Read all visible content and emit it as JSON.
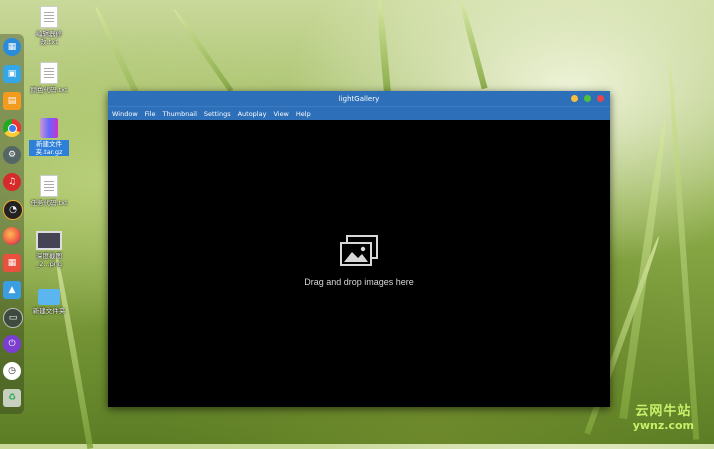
{
  "desktop": {
    "items": [
      {
        "label": "编辑器修\n改.txt",
        "type": "file"
      },
      {
        "label": "颜色代码.txt",
        "type": "file"
      },
      {
        "label": "新建文件\n夹.tar.gz",
        "type": "archive",
        "selected": true
      },
      {
        "label": "任务代码.txt",
        "type": "file"
      },
      {
        "label": "深度截图\n_2...png",
        "type": "image"
      },
      {
        "label": "新建文件夹",
        "type": "folder"
      }
    ]
  },
  "dock": {
    "icons": [
      "launcher-icon",
      "store-icon",
      "files-icon",
      "chrome-icon",
      "settings-icon",
      "netease-music-icon",
      "speedometer-icon",
      "firefox-icon",
      "calendar-icon",
      "image-viewer-icon",
      "deepin-terminal-icon",
      "power-icon",
      "clock-icon",
      "trash-icon"
    ]
  },
  "window": {
    "title": "lightGallery",
    "menu": [
      "Window",
      "File",
      "Thumbnail",
      "Settings",
      "Autoplay",
      "View",
      "Help"
    ],
    "drop_text": "Drag and drop images here"
  },
  "watermark": {
    "line1": "云网牛站",
    "line2": "ywnz.com"
  },
  "colors": {
    "titlebar": "#2d6fb8",
    "btn_min": "#f5be3e",
    "btn_max": "#4cc23a",
    "btn_close": "#e9454d"
  }
}
